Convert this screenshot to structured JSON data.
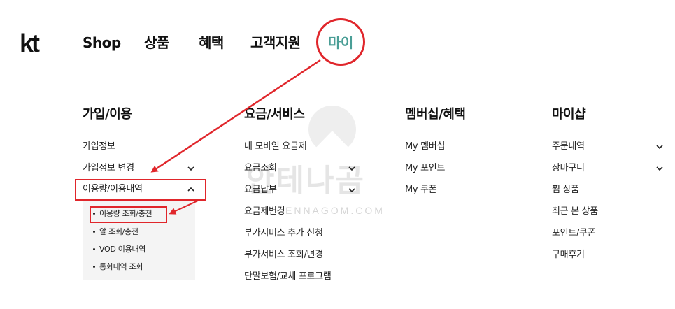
{
  "brand": {
    "logo": "kt"
  },
  "nav": {
    "items": [
      "Shop",
      "상품",
      "혜택",
      "고객지원",
      "마이"
    ],
    "active_index": 4
  },
  "columns": [
    {
      "title": "가입/이용",
      "items": [
        "가입정보",
        "가입정보 변경",
        "이용량/이용내역"
      ],
      "submenu": [
        "이용량 조회/충전",
        "알 조회/충전",
        "VOD 이용내역",
        "통화내역 조회"
      ]
    },
    {
      "title": "요금/서비스",
      "items": [
        "내 모바일 요금제",
        "요금조회",
        "요금납부",
        "요금제변경",
        "부가서비스 추가 신청",
        "부가서비스 조회/변경",
        "단말보험/교체 프로그램"
      ]
    },
    {
      "title": "멤버십/혜택",
      "items": [
        "My 멤버십",
        "My 포인트",
        "My 쿠폰"
      ]
    },
    {
      "title": "마이샵",
      "items": [
        "주문내역",
        "장바구니",
        "찜 상품",
        "최근 본 상품",
        "포인트/쿠폰",
        "구매후기"
      ]
    }
  ],
  "watermark": {
    "text": "안테나곰",
    "url": "ENNAGOM.COM"
  },
  "colors": {
    "accent": "#4a9e96",
    "annotation": "#e0262b",
    "submenu_bg": "#f4f4f4"
  }
}
